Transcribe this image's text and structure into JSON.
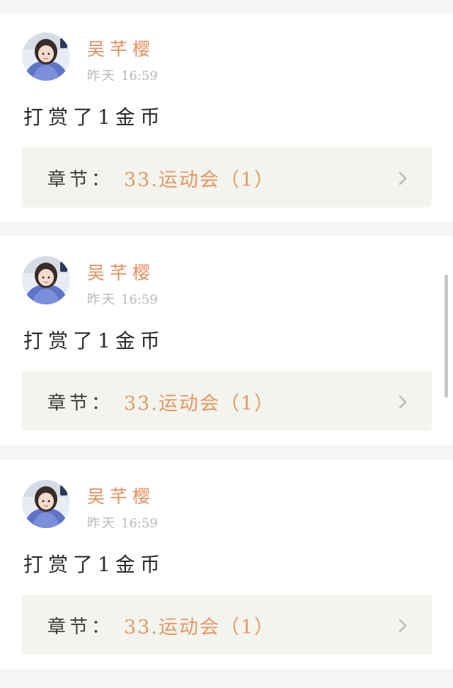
{
  "accent_color": "#e38f5f",
  "feed": {
    "items": [
      {
        "username": "吴芊樱",
        "day": "昨天",
        "time": "16:59",
        "content": "打赏了1金币",
        "chapter_prefix": "章节：",
        "chapter_title": "33.运动会（1）"
      },
      {
        "username": "吴芊樱",
        "day": "昨天",
        "time": "16:59",
        "content": "打赏了1金币",
        "chapter_prefix": "章节：",
        "chapter_title": "33.运动会（1）"
      },
      {
        "username": "吴芊樱",
        "day": "昨天",
        "time": "16:59",
        "content": "打赏了1金币",
        "chapter_prefix": "章节：",
        "chapter_title": "33.运动会（1）"
      }
    ]
  },
  "icons": {
    "avatar": "user-avatar",
    "chevron": "chevron-right-icon"
  }
}
